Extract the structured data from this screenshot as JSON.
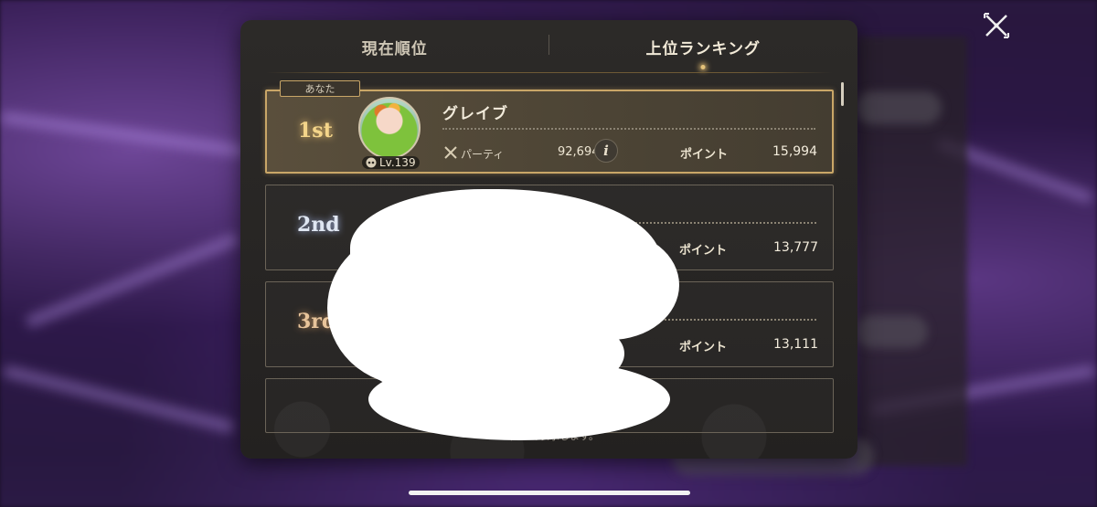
{
  "tabs": {
    "current_rank": "現在順位",
    "top_ranking": "上位ランキング"
  },
  "entries": [
    {
      "tag": "あなた",
      "rank": "1st",
      "name": "グレイブ",
      "level": "Lv.139",
      "party_label": "パーティ",
      "party_power": "92,694",
      "points_label": "ポイント",
      "points": "15,994"
    },
    {
      "rank": "2nd",
      "points_label": "ポイント",
      "points": "13,777"
    },
    {
      "rank": "3rd",
      "points_label": "ポイント",
      "points": "13,111"
    }
  ],
  "footer_note": "…位まで表示します。",
  "icons": {
    "close": "close-x-icon",
    "info": "i",
    "party": "crossed-swords-icon",
    "level": "controller-icon"
  },
  "colors": {
    "accent_gold": "#c9a667",
    "panel_bg": "#2c2a28"
  }
}
